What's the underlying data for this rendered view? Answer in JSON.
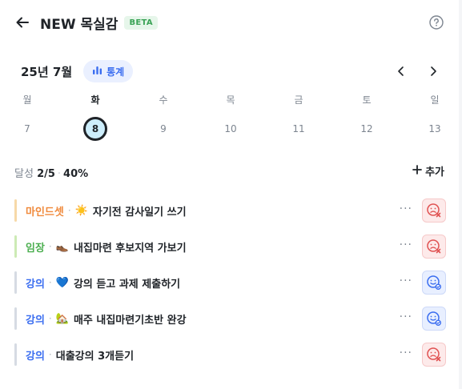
{
  "header": {
    "title": "NEW 목실감",
    "badge": "BETA"
  },
  "calendar": {
    "month_label": "25년 7월",
    "stats_label": "통계",
    "days": [
      {
        "dow": "월",
        "date": "7"
      },
      {
        "dow": "화",
        "date": "8",
        "selected": true
      },
      {
        "dow": "수",
        "date": "9"
      },
      {
        "dow": "목",
        "date": "10"
      },
      {
        "dow": "금",
        "date": "11"
      },
      {
        "dow": "토",
        "date": "12"
      },
      {
        "dow": "일",
        "date": "13"
      }
    ]
  },
  "progress": {
    "label": "달성",
    "count": "2/5",
    "dot": "·",
    "percent": "40%",
    "add_label": "추가"
  },
  "tasks": [
    {
      "category": "마인드셋",
      "category_color": "#f08a3c",
      "bar_color": "#f7d9a8",
      "sep": "·",
      "emoji": "☀️",
      "text": "자기전 감사일기 쓰기",
      "status": "fail"
    },
    {
      "category": "임장",
      "category_color": "#4caf50",
      "bar_color": "#cdebb5",
      "sep": "·",
      "emoji": "👞",
      "text": "내집마련 후보지역 가보기",
      "status": "fail"
    },
    {
      "category": "강의",
      "category_color": "#3a6df0",
      "bar_color": "#d6dbe3",
      "sep": "·",
      "emoji": "💙",
      "text": "강의 듣고 과제 제출하기",
      "status": "ok"
    },
    {
      "category": "강의",
      "category_color": "#3a6df0",
      "bar_color": "#d6dbe3",
      "sep": "·",
      "emoji": "🏡",
      "text": "매주 내집마련기초반 완강",
      "status": "ok"
    },
    {
      "category": "강의",
      "category_color": "#3a6df0",
      "bar_color": "#d6dbe3",
      "sep": "·",
      "emoji": "",
      "text": "대출강의 3개듣기",
      "status": "fail"
    }
  ],
  "more_label": "···",
  "icons": {
    "back": "arrow-left-icon",
    "help": "question-circle-icon",
    "stats": "bar-chart-icon",
    "prev": "chevron-left-icon",
    "next": "chevron-right-icon",
    "add": "plus-icon",
    "fail": "sad-face-x-icon",
    "ok": "happy-face-check-icon"
  },
  "colors": {
    "accent": "#3a6df0",
    "beta": "#3aa356",
    "fail": "#e05252",
    "selected_day_fill": "#cdeefc"
  }
}
